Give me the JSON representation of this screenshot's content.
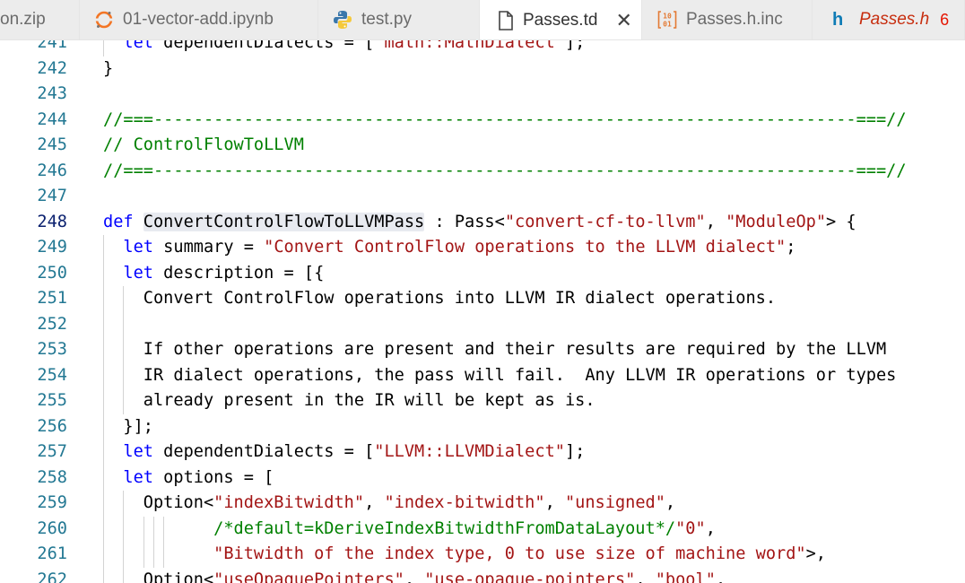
{
  "tabs": [
    {
      "label": "on.zip",
      "icon": "zip-file-icon"
    },
    {
      "label": "01-vector-add.ipynb",
      "icon": "jupyter-icon"
    },
    {
      "label": "test.py",
      "icon": "python-icon"
    },
    {
      "label": "Passes.td",
      "icon": "file-icon",
      "active": true,
      "close": "✕"
    },
    {
      "label": "Passes.h.inc",
      "icon": "binary-file-icon"
    },
    {
      "label": "Passes.h",
      "icon": "c-header-icon",
      "icon_text": "h",
      "badge": "6"
    }
  ],
  "editor": {
    "current_line": "248",
    "lines": [
      {
        "n": "241",
        "text": "  let dependentDialects = [\"math::MathDialect\"];"
      },
      {
        "n": "242",
        "text": "}"
      },
      {
        "n": "243",
        "text": ""
      },
      {
        "n": "244",
        "text": "//===----------------------------------------------------------------------===//"
      },
      {
        "n": "245",
        "text": "// ControlFlowToLLVM"
      },
      {
        "n": "246",
        "text": "//===----------------------------------------------------------------------===//"
      },
      {
        "n": "247",
        "text": ""
      },
      {
        "n": "248",
        "text": "def ConvertControlFlowToLLVMPass : Pass<\"convert-cf-to-llvm\", \"ModuleOp\"> {"
      },
      {
        "n": "249",
        "text": "  let summary = \"Convert ControlFlow operations to the LLVM dialect\";"
      },
      {
        "n": "250",
        "text": "  let description = [{"
      },
      {
        "n": "251",
        "text": "    Convert ControlFlow operations into LLVM IR dialect operations."
      },
      {
        "n": "252",
        "text": ""
      },
      {
        "n": "253",
        "text": "    If other operations are present and their results are required by the LLVM"
      },
      {
        "n": "254",
        "text": "    IR dialect operations, the pass will fail.  Any LLVM IR operations or types"
      },
      {
        "n": "255",
        "text": "    already present in the IR will be kept as is."
      },
      {
        "n": "256",
        "text": "  }];"
      },
      {
        "n": "257",
        "text": "  let dependentDialects = [\"LLVM::LLVMDialect\"];"
      },
      {
        "n": "258",
        "text": "  let options = ["
      },
      {
        "n": "259",
        "text": "    Option<\"indexBitwidth\", \"index-bitwidth\", \"unsigned\","
      },
      {
        "n": "260",
        "text": "           /*default=kDeriveIndexBitwidthFromDataLayout*/\"0\","
      },
      {
        "n": "261",
        "text": "           \"Bitwidth of the index type, 0 to use size of machine word\">,"
      },
      {
        "n": "262",
        "text": "    Option<\"useOpaquePointers\", \"use-opaque-pointers\", \"bool\","
      }
    ]
  },
  "colors": {
    "keyword": "#0000ff",
    "comment": "#008000",
    "string": "#a31515",
    "line_number": "#237893",
    "current_line_number": "#0b216f",
    "highlight": "#e8eaf0"
  }
}
